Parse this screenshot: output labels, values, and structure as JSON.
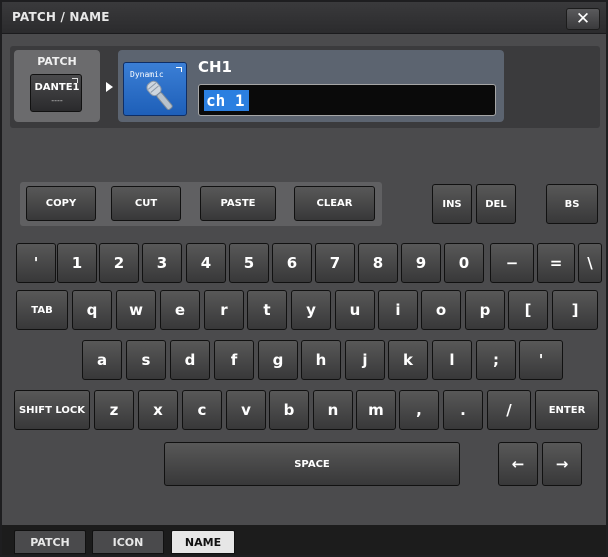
{
  "window": {
    "title": "PATCH / NAME",
    "close_label": "✕"
  },
  "patch": {
    "label": "PATCH",
    "button_name": "DANTE1",
    "button_sub": "----"
  },
  "channel": {
    "icon_label": "Dynamic",
    "icon_name": "dynamic-microphone-icon",
    "id": "CH1",
    "name_value": "ch 1"
  },
  "edit_keys": {
    "copy": "COPY",
    "cut": "CUT",
    "paste": "PASTE",
    "clear": "CLEAR",
    "ins": "INS",
    "del": "DEL",
    "bs": "BS"
  },
  "keyboard": {
    "row1": [
      "'",
      "1",
      "2",
      "3",
      "4",
      "5",
      "6",
      "7",
      "8",
      "9",
      "0",
      "−",
      "=",
      "\\"
    ],
    "row2_tab": "TAB",
    "row2": [
      "q",
      "w",
      "e",
      "r",
      "t",
      "y",
      "u",
      "i",
      "o",
      "p",
      "[",
      "]"
    ],
    "row3": [
      "a",
      "s",
      "d",
      "f",
      "g",
      "h",
      "j",
      "k",
      "l",
      ";",
      "'"
    ],
    "row4_shift": "SHIFT LOCK",
    "row4": [
      "z",
      "x",
      "c",
      "v",
      "b",
      "n",
      "m",
      ",",
      ".",
      "/"
    ],
    "row4_enter": "ENTER",
    "space": "SPACE",
    "left_arrow": "←",
    "right_arrow": "→"
  },
  "tabs": [
    {
      "label": "PATCH",
      "active": false
    },
    {
      "label": "ICON",
      "active": false
    },
    {
      "label": "NAME",
      "active": true
    }
  ],
  "colors": {
    "accent": "#2b7fe0",
    "panel": "#4b4b4d",
    "icon_bg": "#2a6fcc"
  }
}
